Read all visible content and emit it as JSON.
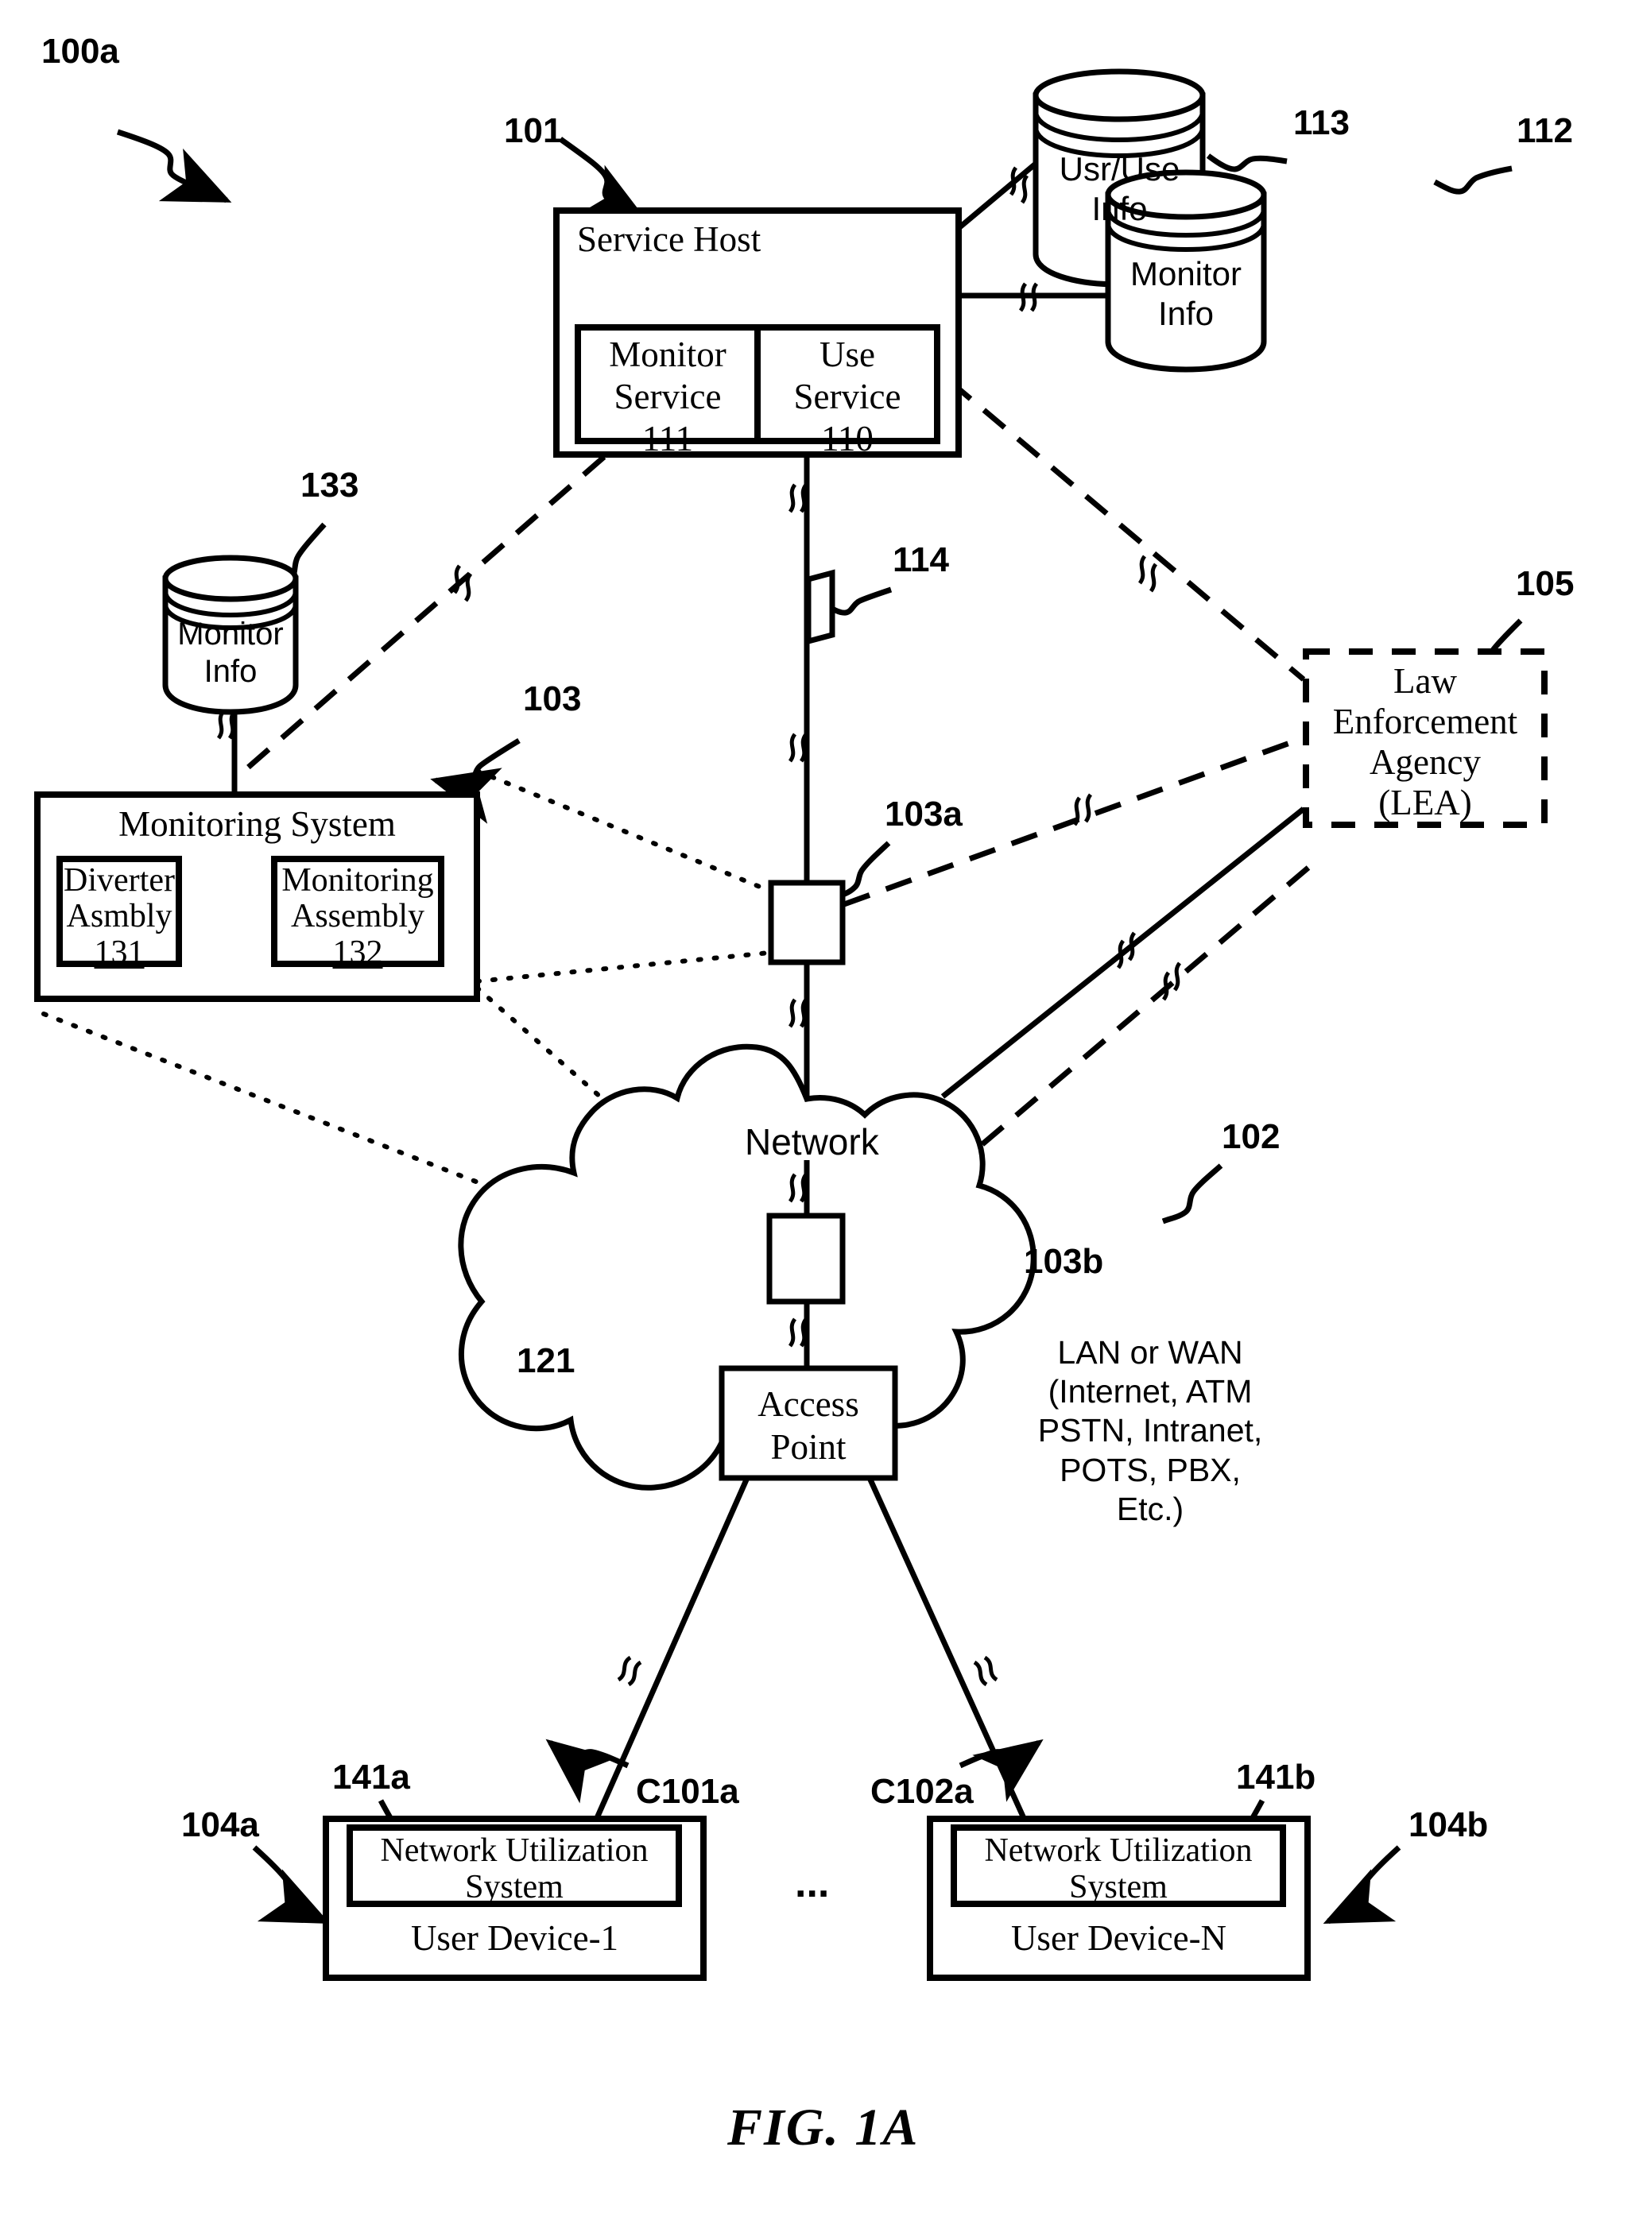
{
  "figure": {
    "caption": "FIG. 1A",
    "system_ref": "100a"
  },
  "nodes": {
    "service_host": {
      "title": "Service Host",
      "ref": "101",
      "children": [
        {
          "name": "monitor-service",
          "line1": "Monitor",
          "line2": "Service",
          "ref": "111"
        },
        {
          "name": "use-service",
          "line1": "Use",
          "line2": "Service",
          "ref": "110"
        }
      ]
    },
    "usr_use_info_db": {
      "line1": "Usr/Use",
      "line2": "Info",
      "ref": "113"
    },
    "monitor_info_db_top": {
      "line1": "Monitor",
      "line2": "Info",
      "ref": "112"
    },
    "monitor_info_db_left": {
      "line1": "Monitor",
      "line2": "Info",
      "ref": "133"
    },
    "monitoring_system": {
      "title": "Monitoring System",
      "ref": "103",
      "children": [
        {
          "name": "diverter-assembly",
          "line1": "Diverter",
          "line2": "Asmbly",
          "ref": "131"
        },
        {
          "name": "monitoring-assembly",
          "line1": "Monitoring",
          "line2": "Assembly",
          "ref": "132"
        }
      ]
    },
    "law_enforcement_agency": {
      "line1": "Law",
      "line2": "Enforcement",
      "line3": "Agency",
      "line4": "(LEA)",
      "ref": "105"
    },
    "network_cloud": {
      "label": "Network",
      "ref": "102",
      "description_lines": [
        "LAN or WAN",
        "(Internet, ATM",
        "PSTN, Intranet,",
        "POTS, PBX,",
        "Etc.)"
      ]
    },
    "access_point": {
      "line1": "Access",
      "line2": "Point",
      "ref": "121"
    },
    "tap_upper": {
      "ref": "103a"
    },
    "tap_lower": {
      "ref": "103b"
    },
    "link_114": {
      "ref": "114"
    },
    "user_device_1": {
      "inner_line1": "Network Utilization",
      "inner_line2": "System",
      "inner_ref": "141a",
      "title": "User  Device-1",
      "ref": "104a",
      "connection_ref": "C101a"
    },
    "user_device_n": {
      "inner_line1": "Network Utilization",
      "inner_line2": "System",
      "inner_ref": "141b",
      "title": "User  Device-N",
      "ref": "104b",
      "connection_ref": "C102a"
    },
    "ellipsis": "..."
  },
  "colors": {
    "stroke": "#000000",
    "background": "#ffffff"
  }
}
